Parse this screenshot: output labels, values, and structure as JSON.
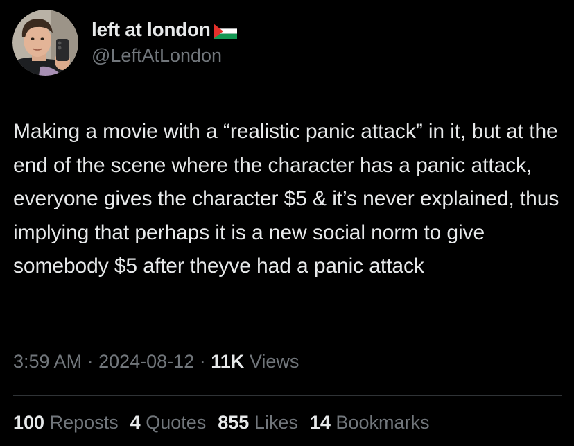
{
  "tweet": {
    "author": {
      "display_name": "left at london",
      "handle": "@LeftAtLondon",
      "flag_icon": "palestine-flag-icon",
      "avatar_icon": "user-avatar"
    },
    "text": "Making a movie with a “realistic panic attack” in it, but at the end of the scene where the character has a panic attack, everyone gives the character $5 & it’s never explained, thus implying that perhaps it is a new social norm to give somebody $5 after theyve had a panic attack",
    "time": "3:59 AM",
    "date": "2024-08-12",
    "separator": "·",
    "views_count": "11K",
    "views_label": "Views",
    "stats": {
      "reposts": {
        "count": "100",
        "label": "Reposts"
      },
      "quotes": {
        "count": "4",
        "label": "Quotes"
      },
      "likes": {
        "count": "855",
        "label": "Likes"
      },
      "bookmarks": {
        "count": "14",
        "label": "Bookmarks"
      }
    }
  },
  "colors": {
    "background": "#000000",
    "primary_text": "#e7e9ea",
    "secondary_text": "#71767b",
    "divider": "#2f3336",
    "flag_black": "#000000",
    "flag_white": "#ffffff",
    "flag_green": "#149954",
    "flag_red": "#e4312b"
  }
}
